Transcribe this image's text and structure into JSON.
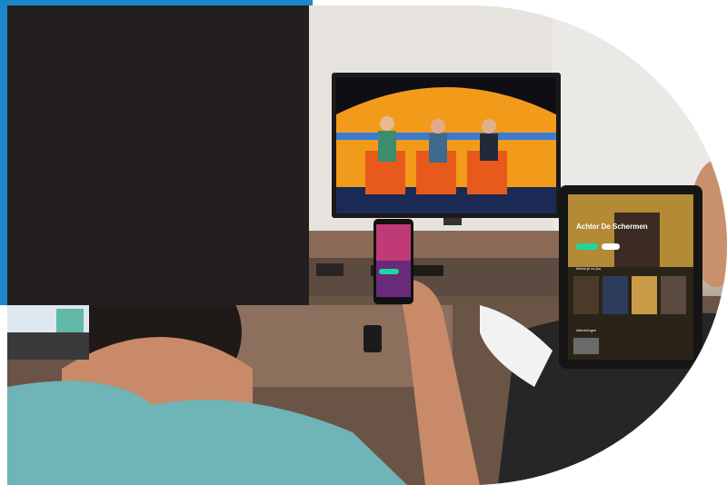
{
  "colors": {
    "frame_blue": "#1a87c9",
    "dark_block": "#231f20",
    "accent_green": "#20d6a0",
    "tv_orange": "#f29b1b"
  },
  "tablet": {
    "title": "Achter De Schermen",
    "row1_label": "Meest je nu jou",
    "row2_label": "Afleveringen"
  }
}
